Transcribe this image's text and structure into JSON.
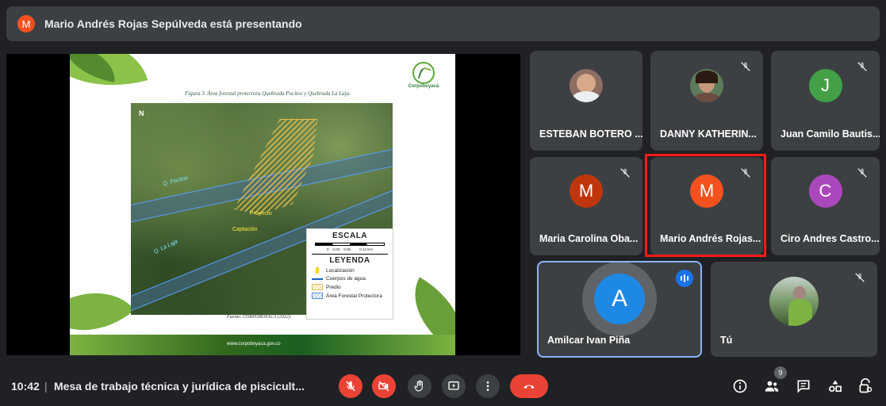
{
  "topbar": {
    "presenter_initial": "M",
    "presenting_text": "Mario Andrés Rojas Sepúlveda está presentando"
  },
  "slide": {
    "caption": "Figura 3. Área forestal protectora Quebrada Pocitos y Quebrada La Laja.",
    "logo_text": "Corpoboyacá",
    "north": "N",
    "map_labels": {
      "river1": "Q. Pocitos",
      "river2": "Q. La Laja",
      "proyecto": "Proyecto",
      "captacion": "Captación"
    },
    "legend": {
      "scale_title": "ESCALA",
      "scale_ticks": "0    0.03    0.06         0.12 Km",
      "legend_title": "LEYENDA",
      "items": [
        "Localización",
        "Cuerpos de agua",
        "Predio",
        "Área Forestal Protectora"
      ]
    },
    "source": "Fuente: CORPOBOYACÁ (2022).",
    "footer": "www.corpoboyaca.gov.co"
  },
  "participants": [
    {
      "name": "ESTEBAN BOTERO ...",
      "type": "photo",
      "muted": false
    },
    {
      "name": "DANNY KATHERIN...",
      "type": "photo",
      "muted": true
    },
    {
      "name": "Juan Camilo Bautis...",
      "type": "letter",
      "initial": "J",
      "color": "#43a047",
      "muted": true
    },
    {
      "name": "Maria Carolina Oba...",
      "type": "letter",
      "initial": "M",
      "color": "#bf360c",
      "muted": true
    },
    {
      "name": "Mario Andrés Rojas...",
      "type": "letter",
      "initial": "M",
      "color": "#f4511e",
      "muted": true
    },
    {
      "name": "Ciro Andres Castro...",
      "type": "letter",
      "initial": "C",
      "color": "#ab47bc",
      "muted": true
    },
    {
      "name": "Amilcar Ivan Piña",
      "type": "letter",
      "initial": "A",
      "color": "#1e88e5",
      "muted": false,
      "speaking": true
    },
    {
      "name": "Tú",
      "type": "photo",
      "muted": true
    }
  ],
  "bottombar": {
    "time": "10:42",
    "separator": "|",
    "meeting_title": "Mesa de trabajo técnica y jurídica de piscicult...",
    "participant_count": "9"
  },
  "colors": {
    "background": "#202124",
    "tile": "#3c4043",
    "danger": "#ea4335",
    "highlight": "#ff1a1a",
    "speaking": "#8ab4f8"
  }
}
